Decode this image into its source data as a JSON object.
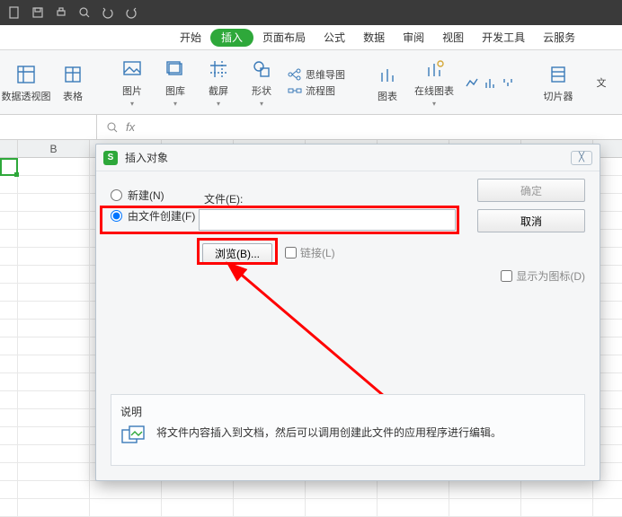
{
  "qat": {
    "icons": [
      "doc",
      "save",
      "print",
      "preview",
      "undo",
      "redo"
    ]
  },
  "tabs": {
    "items": [
      {
        "label": "开始"
      },
      {
        "label": "插入",
        "active": true
      },
      {
        "label": "页面布局"
      },
      {
        "label": "公式"
      },
      {
        "label": "数据"
      },
      {
        "label": "审阅"
      },
      {
        "label": "视图"
      },
      {
        "label": "开发工具"
      },
      {
        "label": "云服务"
      }
    ]
  },
  "ribbon": {
    "groups": [
      {
        "label": "数据透视图"
      },
      {
        "label": "表格"
      },
      {
        "label": "图片"
      },
      {
        "label": "图库"
      },
      {
        "label": "截屏"
      },
      {
        "label": "形状"
      },
      {
        "label": "思维导图"
      },
      {
        "label": "流程图"
      },
      {
        "label": "图表"
      },
      {
        "label": "在线图表"
      },
      {
        "label": "切片器"
      },
      {
        "label": "文"
      }
    ],
    "small_icons": [
      "spark-line",
      "spark-col",
      "spark-winloss"
    ]
  },
  "sheet": {
    "col_b": "B"
  },
  "formula_bar": {
    "fx": "fx"
  },
  "dialog": {
    "title": "插入对象",
    "close_glyph": "☒",
    "radio_new": "新建(N)",
    "radio_fromfile": "由文件创建(F)",
    "file_label": "文件(E):",
    "browse": "浏览(B)...",
    "link": "链接(L)",
    "show_as_icon": "显示为图标(D)",
    "ok": "确定",
    "cancel": "取消",
    "desc_title": "说明",
    "desc_text": "将文件内容插入到文档，然后可以调用创建此文件的应用程序进行编辑。"
  }
}
